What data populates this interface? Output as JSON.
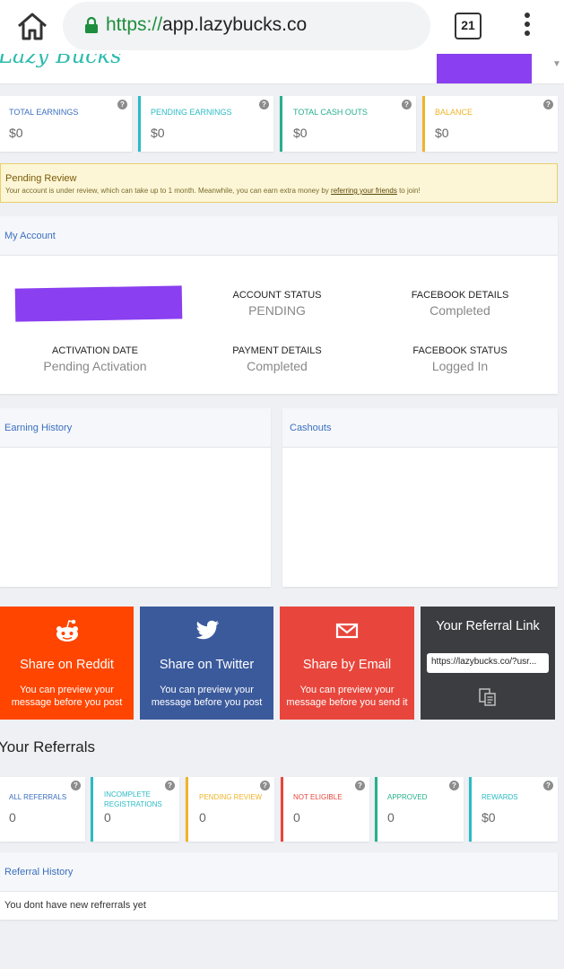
{
  "browser": {
    "url_scheme": "https://",
    "url_host": "app.lazybucks.co",
    "tab_count": "21"
  },
  "app": {
    "logo": "Lazy Bucks"
  },
  "stats": [
    {
      "label": "TOTAL EARNINGS",
      "value": "$0",
      "color": "#3b6fbf"
    },
    {
      "label": "PENDING EARNINGS",
      "value": "$0",
      "color": "#2bbbc5"
    },
    {
      "label": "TOTAL CASH OUTS",
      "value": "$0",
      "color": "#26b08c"
    },
    {
      "label": "BALANCE",
      "value": "$0",
      "color": "#f0b429"
    }
  ],
  "alert": {
    "title": "Pending Review",
    "text_before": "Your account is under review, which can take up to 1 month. Meanwhile, you can earn extra money by ",
    "link": "referring your friends",
    "text_after": " to join!"
  },
  "account": {
    "title": "My Account",
    "fields": [
      {
        "label": "ACCOUNT STATUS",
        "value": "PENDING"
      },
      {
        "label": "FACEBOOK DETAILS",
        "value": "Completed"
      },
      {
        "label": "ACTIVATION DATE",
        "value": "Pending Activation"
      },
      {
        "label": "PAYMENT DETAILS",
        "value": "Completed"
      },
      {
        "label": "FACEBOOK STATUS",
        "value": "Logged In"
      }
    ]
  },
  "history": {
    "earning_title": "Earning History",
    "cashouts_title": "Cashouts"
  },
  "share": {
    "reddit": {
      "title": "Share on Reddit",
      "desc_line1": "You can preview your",
      "desc_line2": "message before you post",
      "color": "#ff4500"
    },
    "twitter": {
      "title": "Share on Twitter",
      "desc_line1": "You can preview your",
      "desc_line2": "message before you post",
      "color": "#3b5a9c"
    },
    "email": {
      "title": "Share by Email",
      "desc_line1": "You can preview your",
      "desc_line2": "message before you send it",
      "color": "#e8463c"
    },
    "referral": {
      "title": "Your Referral Link",
      "link": "https://lazybucks.co/?usr...",
      "color": "#3c3d40"
    }
  },
  "referrals": {
    "heading": "Your Referrals",
    "stats": [
      {
        "label": "ALL REFERRALS",
        "value": "0",
        "color": "#3b6fbf"
      },
      {
        "label": "INCOMPLETE REGISTRATIONS",
        "value": "0",
        "color": "#2bbbc5"
      },
      {
        "label": "PENDING REVIEW",
        "value": "0",
        "color": "#f0b429"
      },
      {
        "label": "NOT ELIGIBLE",
        "value": "0",
        "color": "#e8463c"
      },
      {
        "label": "APPROVED",
        "value": "0",
        "color": "#26b08c"
      },
      {
        "label": "REWARDS",
        "value": "$0",
        "color": "#2bbbc5"
      }
    ],
    "history_title": "Referral History",
    "empty_text": "You dont have new refrerrals yet"
  }
}
